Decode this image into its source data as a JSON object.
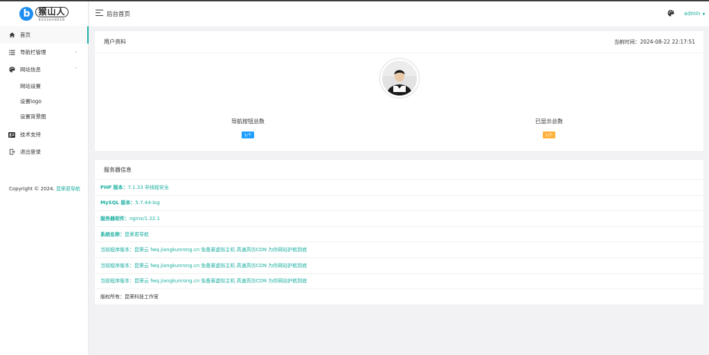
{
  "logo": {
    "letter": "b",
    "cn": "猴山人",
    "en": "BAOSHANREN"
  },
  "sidebar": {
    "items": [
      {
        "label": "首页",
        "icon": "home-icon"
      },
      {
        "label": "导航栏管理",
        "icon": "list-icon",
        "arrow": "›"
      },
      {
        "label": "网站信息",
        "icon": "palette-icon",
        "arrow": "˅"
      },
      {
        "label": "技术支持",
        "icon": "id-card-icon"
      },
      {
        "label": "退出登录",
        "icon": "logout-icon"
      }
    ],
    "sub_items": [
      {
        "label": "网站设置"
      },
      {
        "label": "设置logo"
      },
      {
        "label": "设置背景图"
      }
    ],
    "copyright_text": "Copyright © 2024.",
    "copyright_brand": "昆荣君导航"
  },
  "header": {
    "title": "后台首页",
    "user": "admin",
    "user_caret": "▼"
  },
  "profile": {
    "title": "用户资料",
    "time_label": "当前时间：",
    "time_value": "2024-08-22 22:17:51",
    "stats": [
      {
        "label": "导航按钮总数",
        "value": "1/个",
        "color": "#1e9fff"
      },
      {
        "label": "已显示总数",
        "value": "1/个",
        "color": "#ffb13b"
      }
    ]
  },
  "server": {
    "title": "服务器信息",
    "rows": [
      {
        "key": "PHP 版本：",
        "value": "7.1.33 非线程安全"
      },
      {
        "key": "MySQL 版本：",
        "value": "5.7.44-log"
      },
      {
        "key": "服务器软件：",
        "value": "nginx/1.22.1"
      },
      {
        "key": "系统名称：",
        "value": "昆荣君导航"
      },
      {
        "key": "当前程序版本：",
        "value": "昆荣云 fwq.jiangkunrong.cn 免备案虚拟主机 高速高仿CDN 为你网站护航到底"
      },
      {
        "key": "当前程序版本：",
        "value": "昆荣云 fwq.jiangkunrong.cn 免备案虚拟主机 高速高仿CDN 为你网站护航到底"
      },
      {
        "key": "当前程序版本：",
        "value": "昆荣云 fwq.jiangkunrong.cn 免备案虚拟主机 高速高仿CDN 为你网站护航到底"
      },
      {
        "key": "版权所有：",
        "value": "昆荣科技工作室"
      }
    ]
  },
  "colors": {
    "accent": "#1aaea0",
    "blue_badge": "#1e9fff",
    "orange_badge": "#ffb13b"
  }
}
